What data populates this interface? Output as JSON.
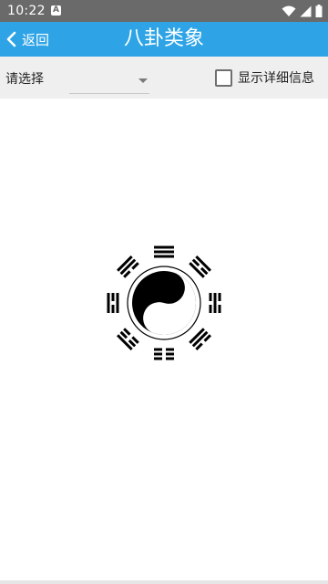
{
  "status_bar": {
    "time": "10:22",
    "notification_icon": "a-notification-icon",
    "icons": [
      "wifi-icon",
      "signal-icon",
      "battery-icon"
    ]
  },
  "app_bar": {
    "back_label": "返回",
    "title": "八卦类象",
    "color": "#2ea4e6"
  },
  "toolbar": {
    "select_label": "请选择",
    "dropdown_value": "",
    "show_details_label": "显示详细信息",
    "show_details_checked": false
  },
  "content": {
    "image": "bagua-taiji-diagram"
  }
}
